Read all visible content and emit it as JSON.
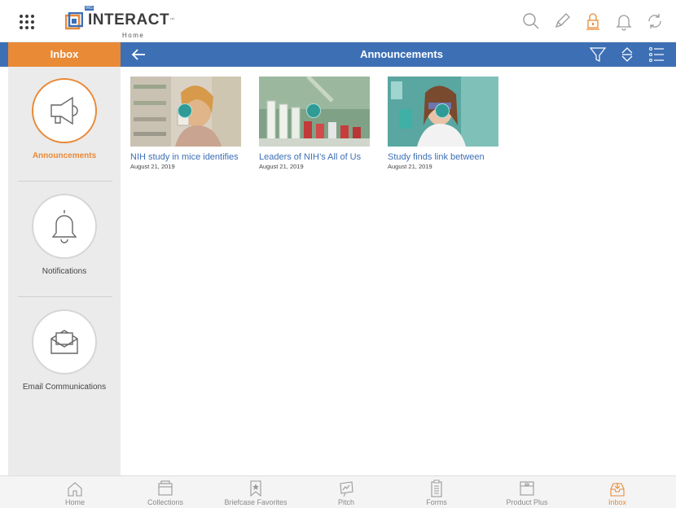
{
  "header": {
    "logo_text": "INTERACT",
    "logo_tm": "™",
    "logo_badge": "IRG",
    "subtitle": "Home"
  },
  "bar": {
    "inbox_label": "Inbox",
    "title": "Announcements"
  },
  "sidebar": {
    "items": [
      {
        "label": "Announcements",
        "icon": "megaphone-icon",
        "active": true
      },
      {
        "label": "Notifications",
        "icon": "bell-icon",
        "active": false
      },
      {
        "label": "Email Communications",
        "icon": "envelope-icon",
        "active": false
      }
    ]
  },
  "cards": [
    {
      "title": "NIH study in mice identifies",
      "date": "August 21, 2019"
    },
    {
      "title": "Leaders of NIH’s All of Us",
      "date": "August 21, 2019"
    },
    {
      "title": "Study finds link between",
      "date": "August 21, 2019"
    }
  ],
  "bottom_nav": [
    {
      "label": "Home",
      "icon": "home-icon"
    },
    {
      "label": "Collections",
      "icon": "folder-icon"
    },
    {
      "label": "Briefcase Favorites",
      "icon": "bookmark-star-icon"
    },
    {
      "label": "Pitch",
      "icon": "presentation-icon"
    },
    {
      "label": "Forms",
      "icon": "clipboard-icon"
    },
    {
      "label": "Product Plus",
      "icon": "box-icon"
    },
    {
      "label": "Inbox",
      "icon": "inbox-icon",
      "active": true
    }
  ],
  "colors": {
    "accent_orange": "#e98a37",
    "primary_blue": "#3d6fb5",
    "sidebar_bg": "#ebebeb"
  }
}
